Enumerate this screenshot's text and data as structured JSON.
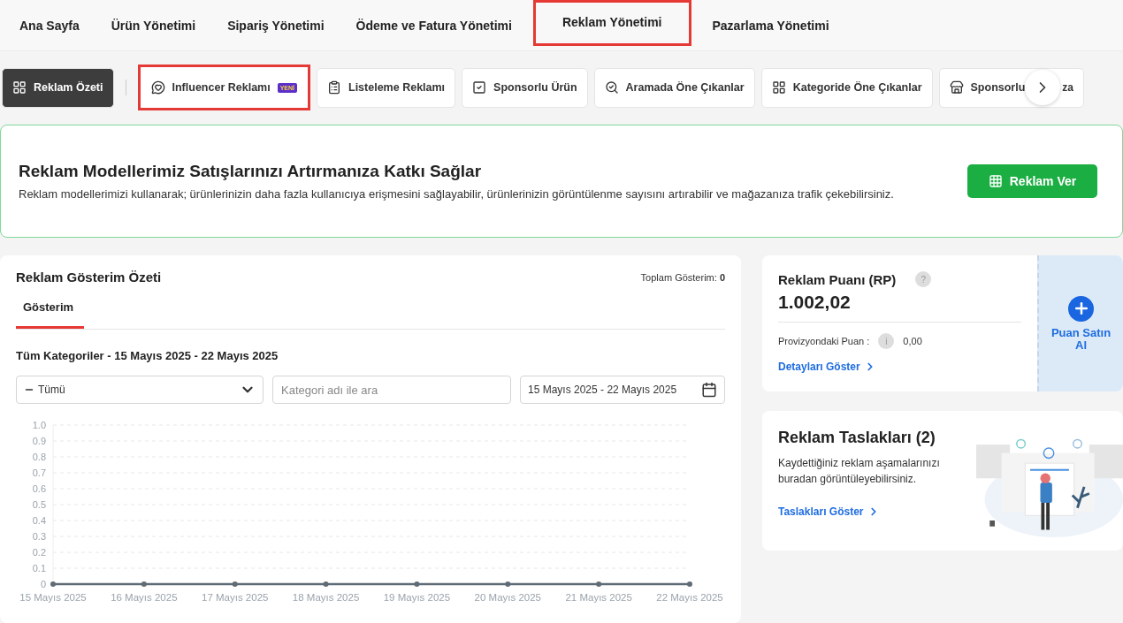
{
  "top_nav": [
    {
      "label": "Ana Sayfa",
      "highlighted": false
    },
    {
      "label": "Ürün Yönetimi",
      "highlighted": false
    },
    {
      "label": "Sipariş Yönetimi",
      "highlighted": false
    },
    {
      "label": "Ödeme ve Fatura Yönetimi",
      "highlighted": false
    },
    {
      "label": "Reklam Yönetimi",
      "highlighted": true
    },
    {
      "label": "Pazarlama Yönetimi",
      "highlighted": false
    }
  ],
  "sub_tabs": [
    {
      "label": "Reklam Özeti",
      "selected": true,
      "highlighted": false
    },
    {
      "label": "Influencer Reklamı",
      "badge": "YENİ",
      "selected": false,
      "highlighted": true
    },
    {
      "label": "Listeleme Reklamı",
      "selected": false,
      "highlighted": false
    },
    {
      "label": "Sponsorlu Ürün",
      "selected": false,
      "highlighted": false
    },
    {
      "label": "Aramada Öne Çıkanlar",
      "selected": false,
      "highlighted": false
    },
    {
      "label": "Kategoride Öne Çıkanlar",
      "selected": false,
      "highlighted": false
    },
    {
      "label": "Sponsorlu",
      "label_end": "za",
      "selected": false,
      "highlighted": false
    }
  ],
  "banner": {
    "title": "Reklam Modellerimiz Satışlarınızı Artırmanıza Katkı Sağlar",
    "text": "Reklam modellerimizi kullanarak; ürünlerinizin daha fazla kullanıcıya erişmesini sağlayabilir, ürünlerinizin görüntülenme sayısını artırabilir ve mağazanıza trafik çekebilirsiniz.",
    "button": "Reklam Ver"
  },
  "summary": {
    "title": "Reklam Gösterim Özeti",
    "total_label": "Toplam Gösterim:",
    "total_value": "0",
    "tabs": [
      {
        "label": "Gösterim",
        "selected": true
      }
    ],
    "range_title": "Tüm Kategoriler - 15 Mayıs 2025 - 22 Mayıs 2025",
    "select_value": "Tümü",
    "search": {
      "placeholder": "Kategori adı ile ara"
    },
    "date_range": "15 Mayıs 2025 - 22 Mayıs 2025",
    "chart_data": {
      "type": "line",
      "categories": [
        "15 Mayıs 2025",
        "16 Mayıs 2025",
        "17 Mayıs 2025",
        "18 Mayıs 2025",
        "19 Mayıs 2025",
        "20 Mayıs 2025",
        "21 Mayıs 2025",
        "22 Mayıs 2025"
      ],
      "series": [
        {
          "color": "#5f6b75",
          "marker": "circle",
          "values": [
            0,
            0,
            0,
            0,
            0,
            0,
            0,
            0
          ]
        }
      ],
      "grid": true,
      "ylim": [
        0,
        1
      ],
      "yticks": [
        {
          "value": 0,
          "label": "0"
        },
        {
          "value": 0.1,
          "label": "0.1"
        },
        {
          "value": 0.2,
          "label": "0.2"
        },
        {
          "value": 0.3,
          "label": "0.3"
        },
        {
          "value": 0.4,
          "label": "0.4"
        },
        {
          "value": 0.5,
          "label": "0.5"
        },
        {
          "value": 0.6,
          "label": "0.6"
        },
        {
          "value": 0.7,
          "label": "0.7"
        },
        {
          "value": 0.8,
          "label": "0.8"
        },
        {
          "value": 0.9,
          "label": "0.9"
        },
        {
          "value": 1,
          "label": "1.0"
        }
      ]
    }
  },
  "points": {
    "title": "Reklam Puanı (RP)",
    "help": "?",
    "value": "1.002,02",
    "pending_label": "Provizyondaki Puan :",
    "info": "i",
    "pending_value": "0,00",
    "link": "Detayları Göster",
    "buy": "Puan Satın Al"
  },
  "drafts": {
    "title": "Reklam Taslakları (2)",
    "text": "Kaydettiğiniz reklam aşamalarınızı buradan görüntüleyebilirsiniz.",
    "link": "Taslakları Göster"
  }
}
